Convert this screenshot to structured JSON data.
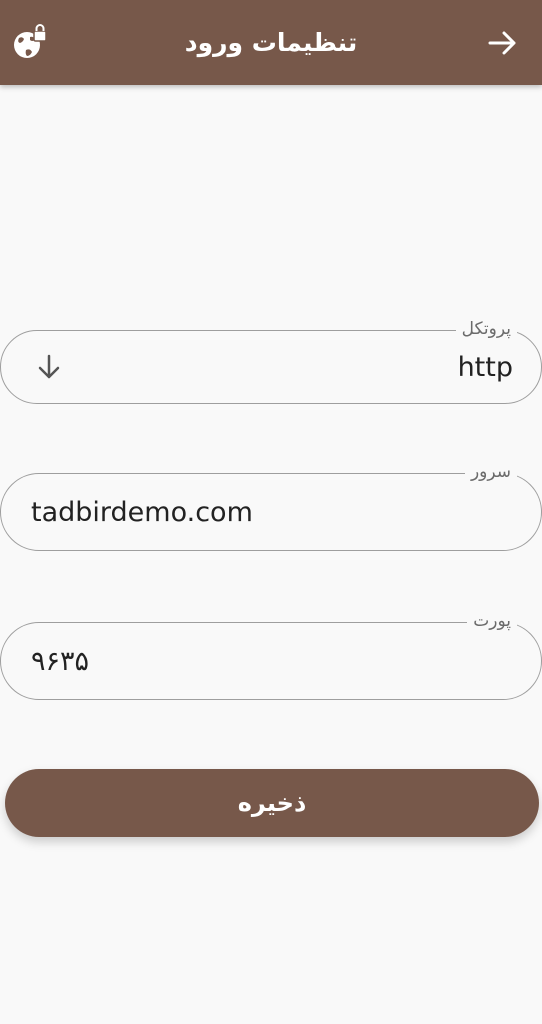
{
  "header": {
    "title": "تنظیمات ورود",
    "back_icon": "arrow-right-icon",
    "network_icon": "network-lock-icon"
  },
  "form": {
    "protocol": {
      "label": "پروتکل",
      "value": "http"
    },
    "server": {
      "label": "سرور",
      "value": "tadbirdemo.com"
    },
    "port": {
      "label": "پورت",
      "value": "۹۶۳۵"
    }
  },
  "save_label": "ذخیره",
  "colors": {
    "primary": "#77584a",
    "background": "#f9f9f9",
    "border": "#9e9e9e",
    "label": "#6b6b6b"
  }
}
